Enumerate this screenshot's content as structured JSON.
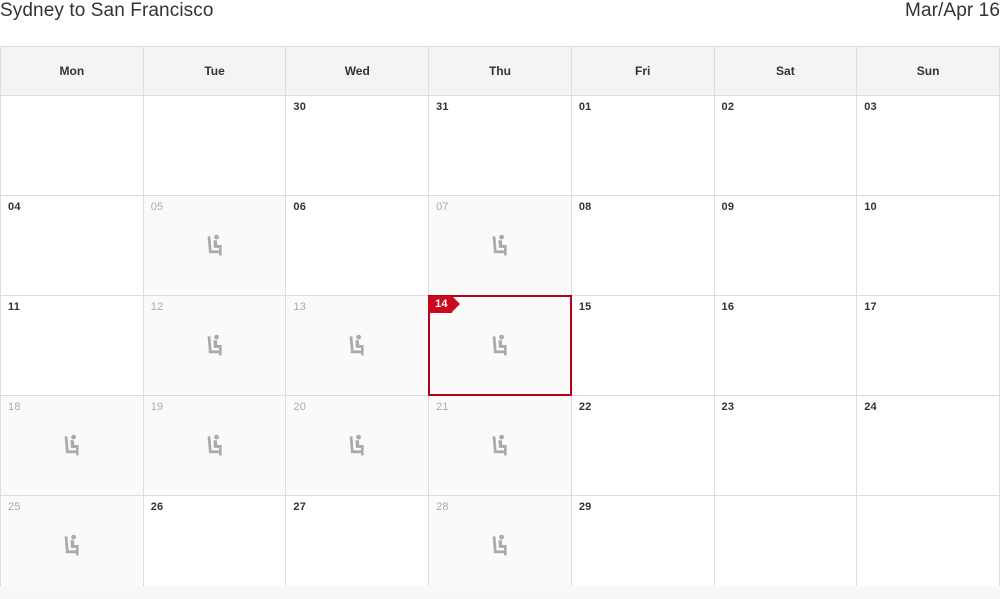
{
  "header": {
    "route": "Sydney to San Francisco",
    "period": "Mar/Apr 16"
  },
  "colors": {
    "selected_border": "#b20417",
    "selected_badge": "#cc0a1e",
    "header_bg": "#f4f4f4",
    "grid_border": "#dddddd",
    "daynum_active": "#333333",
    "daynum_muted": "#aaaaaa",
    "seat_icon": "#aaaaaa",
    "flight_cell_bg": "#fafafa"
  },
  "calendar": {
    "weekday_headers": [
      "Mon",
      "Tue",
      "Wed",
      "Thu",
      "Fri",
      "Sat",
      "Sun"
    ],
    "icon_name": "airline-seat-icon",
    "selected_day": "14",
    "weeks": [
      [
        {
          "day": "",
          "flight": false,
          "selected": false,
          "blank": true
        },
        {
          "day": "",
          "flight": false,
          "selected": false,
          "blank": true
        },
        {
          "day": "30",
          "flight": false,
          "selected": false,
          "blank": false
        },
        {
          "day": "31",
          "flight": false,
          "selected": false,
          "blank": false
        },
        {
          "day": "01",
          "flight": false,
          "selected": false,
          "blank": false
        },
        {
          "day": "02",
          "flight": false,
          "selected": false,
          "blank": false
        },
        {
          "day": "03",
          "flight": false,
          "selected": false,
          "blank": false
        }
      ],
      [
        {
          "day": "04",
          "flight": false,
          "selected": false,
          "blank": false
        },
        {
          "day": "05",
          "flight": true,
          "selected": false,
          "blank": false
        },
        {
          "day": "06",
          "flight": false,
          "selected": false,
          "blank": false
        },
        {
          "day": "07",
          "flight": true,
          "selected": false,
          "blank": false
        },
        {
          "day": "08",
          "flight": false,
          "selected": false,
          "blank": false
        },
        {
          "day": "09",
          "flight": false,
          "selected": false,
          "blank": false
        },
        {
          "day": "10",
          "flight": false,
          "selected": false,
          "blank": false
        }
      ],
      [
        {
          "day": "11",
          "flight": false,
          "selected": false,
          "blank": false
        },
        {
          "day": "12",
          "flight": true,
          "selected": false,
          "blank": false
        },
        {
          "day": "13",
          "flight": true,
          "selected": false,
          "blank": false
        },
        {
          "day": "14",
          "flight": true,
          "selected": true,
          "blank": false
        },
        {
          "day": "15",
          "flight": false,
          "selected": false,
          "blank": false
        },
        {
          "day": "16",
          "flight": false,
          "selected": false,
          "blank": false
        },
        {
          "day": "17",
          "flight": false,
          "selected": false,
          "blank": false
        }
      ],
      [
        {
          "day": "18",
          "flight": true,
          "selected": false,
          "blank": false
        },
        {
          "day": "19",
          "flight": true,
          "selected": false,
          "blank": false
        },
        {
          "day": "20",
          "flight": true,
          "selected": false,
          "blank": false
        },
        {
          "day": "21",
          "flight": true,
          "selected": false,
          "blank": false
        },
        {
          "day": "22",
          "flight": false,
          "selected": false,
          "blank": false
        },
        {
          "day": "23",
          "flight": false,
          "selected": false,
          "blank": false
        },
        {
          "day": "24",
          "flight": false,
          "selected": false,
          "blank": false
        }
      ],
      [
        {
          "day": "25",
          "flight": true,
          "selected": false,
          "blank": false
        },
        {
          "day": "26",
          "flight": false,
          "selected": false,
          "blank": false
        },
        {
          "day": "27",
          "flight": false,
          "selected": false,
          "blank": false
        },
        {
          "day": "28",
          "flight": true,
          "selected": false,
          "blank": false
        },
        {
          "day": "29",
          "flight": false,
          "selected": false,
          "blank": false
        },
        {
          "day": "",
          "flight": false,
          "selected": false,
          "blank": true
        },
        {
          "day": "",
          "flight": false,
          "selected": false,
          "blank": true
        }
      ]
    ]
  }
}
